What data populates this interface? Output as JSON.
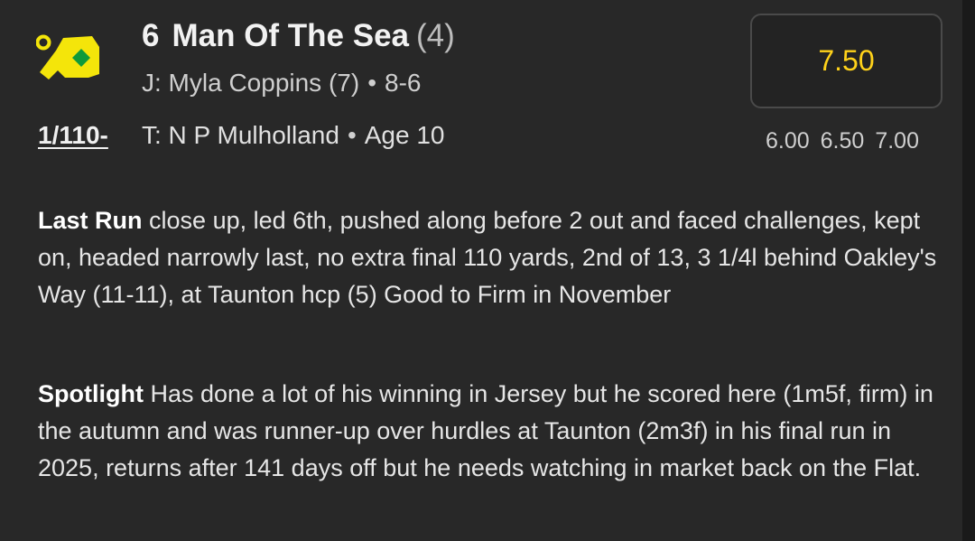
{
  "runner": {
    "number": "6",
    "name": "Man Of The Sea",
    "draw": "(4)",
    "jockey": "J: Myla Coppins (7)",
    "weight": "8-6",
    "trainer": "T: N P Mulholland",
    "age": "Age 10",
    "form": "1/110-",
    "separator": "•"
  },
  "silks": {
    "icon": "jockey-silks-icon",
    "body_color": "#f4e50a",
    "diamond_color": "#0f9a3a",
    "cap_color": "#f4e50a"
  },
  "odds": {
    "current": "7.50",
    "previous": [
      "6.00",
      "6.50",
      "7.00"
    ],
    "accent_color": "#ffd21a"
  },
  "last_run": {
    "label": "Last Run",
    "text": "close up, led 6th, pushed along before 2 out and faced challenges, kept on, headed narrowly last, no extra final 110 yards, 2nd of 13, 3 1/4l behind Oakley's Way (11-11), at Taunton hcp (5) Good to Firm in November"
  },
  "spotlight": {
    "label": "Spotlight",
    "text": "Has done a lot of his winning in Jersey but he scored here (1m5f, firm) in the autumn and was runner-up over hurdles at Taunton (2m3f) in his final run in 2025, returns after 141 days off but he needs watching in market back on the Flat."
  }
}
